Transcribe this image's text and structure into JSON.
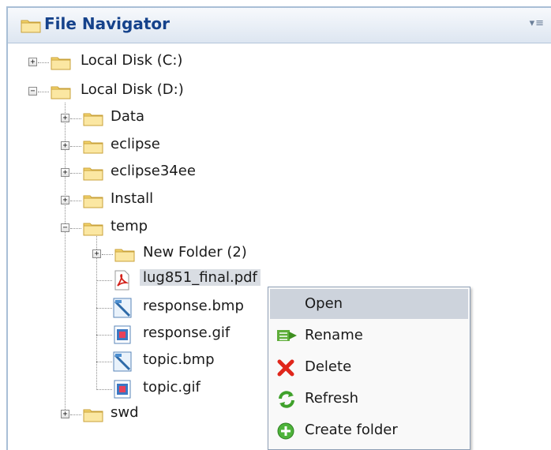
{
  "panel": {
    "title": "File Navigator",
    "menu_icon": "menu-icon"
  },
  "tree": {
    "drive_c": "Local Disk (C:)",
    "drive_d": "Local Disk (D:)",
    "data": "Data",
    "eclipse": "eclipse",
    "eclipse34ee": "eclipse34ee",
    "install": "Install",
    "temp": "temp",
    "new_folder": "New Folder (2)",
    "pdf": "lug851_final.pdf",
    "response_bmp": "response.bmp",
    "response_gif": "response.gif",
    "topic_bmp": "topic.bmp",
    "topic_gif": "topic.gif",
    "swd": "swd"
  },
  "context_menu": {
    "open": "Open",
    "rename": "Rename",
    "delete": "Delete",
    "refresh": "Refresh",
    "create_folder": "Create folder"
  },
  "colors": {
    "header_text": "#15428b",
    "selection": "#d9dde3",
    "menu_highlight": "#cdd3dc",
    "folder": "#f5d77a"
  }
}
